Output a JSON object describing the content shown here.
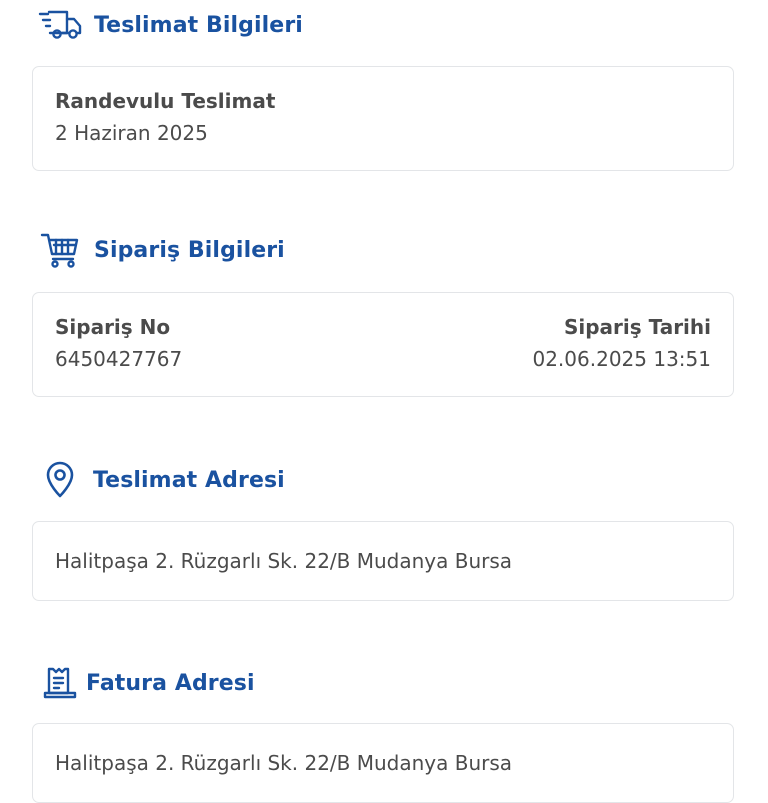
{
  "delivery": {
    "title": "Teslimat Bilgileri",
    "icon": "delivery-truck-icon",
    "label": "Randevulu Teslimat",
    "date": "2 Haziran 2025"
  },
  "order": {
    "title": "Sipariş Bilgileri",
    "icon": "shopping-cart-icon",
    "no_label": "Sipariş No",
    "no_value": "6450427767",
    "date_label": "Sipariş Tarihi",
    "date_value": "02.06.2025 13:51"
  },
  "shipping_address": {
    "title": "Teslimat Adresi",
    "icon": "map-pin-icon",
    "address": "Halitpaşa 2. Rüzgarlı Sk. 22/B Mudanya Bursa"
  },
  "billing_address": {
    "title": "Fatura Adresi",
    "icon": "receipt-icon",
    "address": "Halitpaşa 2. Rüzgarlı Sk. 22/B Mudanya Bursa"
  },
  "colors": {
    "accent": "#1a52a0",
    "text": "#4b4b4b",
    "card_border": "#e3e5e8"
  }
}
